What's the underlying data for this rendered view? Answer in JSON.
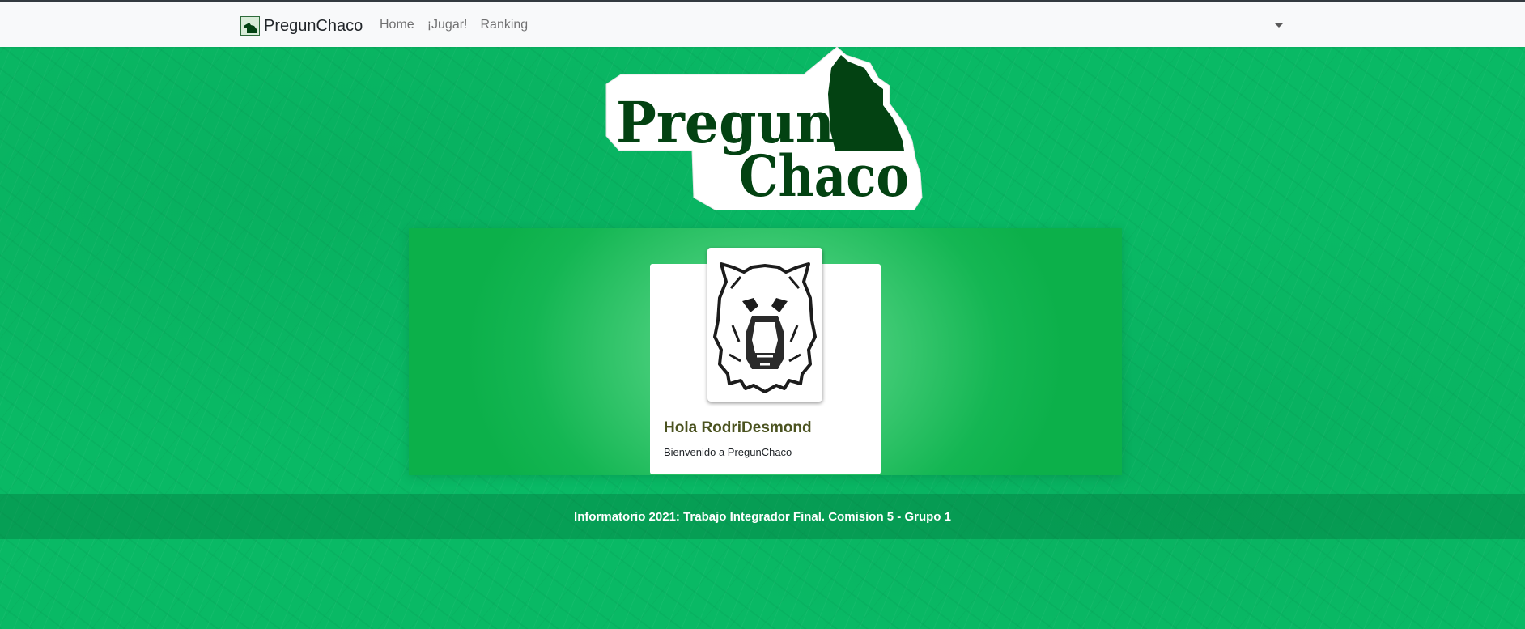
{
  "navbar": {
    "brand": "PregunChaco",
    "links": [
      {
        "label": "Home"
      },
      {
        "label": "¡Jugar!"
      },
      {
        "label": "Ranking"
      }
    ],
    "dropdown_icon": "caret-down-icon"
  },
  "logo": {
    "line1": "Pregun",
    "line2": "Chaco"
  },
  "welcome_card": {
    "title": "Hola RodriDesmond",
    "subtitle": "Bienvenido a PregunChaco",
    "avatar_icon": "capybara-icon"
  },
  "footer": {
    "text": "Informatorio 2021: Trabajo Integrador Final. Comision 5 - Grupo 1"
  },
  "colors": {
    "background": "#09b965",
    "logo_dark": "#034212",
    "card_title": "#4b5320"
  }
}
